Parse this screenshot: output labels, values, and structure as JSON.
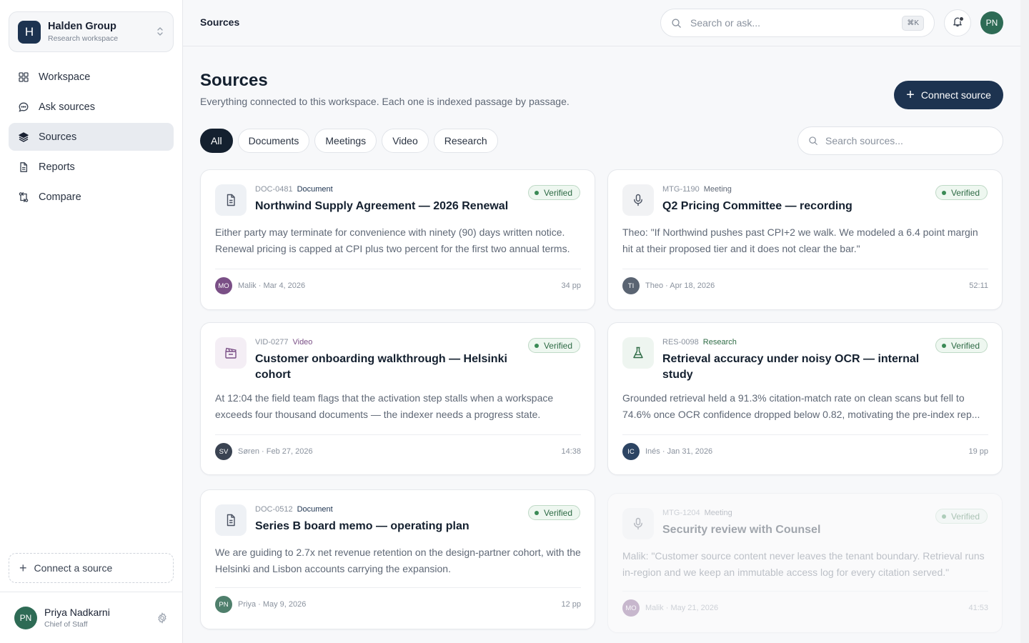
{
  "workspace": {
    "logo_letter": "H",
    "name": "Halden Group",
    "subtitle": "Research workspace"
  },
  "nav": [
    {
      "label": "Workspace",
      "icon": "grid-icon",
      "active": false
    },
    {
      "label": "Ask sources",
      "icon": "chat-icon",
      "active": false
    },
    {
      "label": "Sources",
      "icon": "layers-icon",
      "active": true
    },
    {
      "label": "Reports",
      "icon": "document-icon",
      "active": false
    },
    {
      "label": "Compare",
      "icon": "compare-icon",
      "active": false
    }
  ],
  "sidebar_connect_label": "Connect a source",
  "user": {
    "initials": "PN",
    "name": "Priya Nadkarni",
    "role": "Chief of Staff"
  },
  "topbar": {
    "breadcrumb": "Sources",
    "search_placeholder": "Search or ask...",
    "shortcut": "⌘K",
    "avatar_initials": "PN"
  },
  "page": {
    "title": "Sources",
    "subtitle": "Everything connected to this workspace. Each one is indexed passage by passage.",
    "connect_button": "Connect source",
    "search_placeholder": "Search sources..."
  },
  "filters": [
    "All",
    "Documents",
    "Meetings",
    "Video",
    "Research"
  ],
  "cards": [
    {
      "id": "DOC-0481",
      "kind": "Document",
      "kind_color": "#1d3350",
      "icon": "document-icon",
      "icon_bg": "#eef1f5",
      "title": "Northwind Supply Agreement — 2026 Renewal",
      "status": "Verified",
      "excerpt": "Either party may terminate for convenience with ninety (90) days written notice. Renewal pricing is capped at CPI plus two percent for the first two annual terms.",
      "author_initials": "MO",
      "author_color": "#7a4f86",
      "byline": "Malik · Mar 4, 2026",
      "length": "34 pp"
    },
    {
      "id": "MTG-1190",
      "kind": "Meeting",
      "kind_color": "#5f6876",
      "icon": "microphone-icon",
      "icon_bg": "#f1f2f4",
      "title": "Q2 Pricing Committee — recording",
      "status": "Verified",
      "excerpt": "Theo: \"If Northwind pushes past CPI+2 we walk. We modeled a 6.4 point margin hit at their proposed tier and it does not clear the bar.\"",
      "author_initials": "TI",
      "author_color": "#5a6472",
      "byline": "Theo · Apr 18, 2026",
      "length": "52:11"
    },
    {
      "id": "VID-0277",
      "kind": "Video",
      "kind_color": "#7a4f86",
      "icon": "clapperboard-icon",
      "icon_bg": "#f4eef5",
      "title": "Customer onboarding walkthrough — Helsinki cohort",
      "status": "Verified",
      "excerpt": "At 12:04 the field team flags that the activation step stalls when a workspace exceeds four thousand documents — the indexer needs a progress state.",
      "author_initials": "SV",
      "author_color": "#3a4352",
      "byline": "Søren · Feb 27, 2026",
      "length": "14:38"
    },
    {
      "id": "RES-0098",
      "kind": "Research",
      "kind_color": "#2e6b45",
      "icon": "flask-icon",
      "icon_bg": "#eef5f0",
      "title": "Retrieval accuracy under noisy OCR — internal study",
      "status": "Verified",
      "excerpt": "Grounded retrieval held a 91.3% citation-match rate on clean scans but fell to 74.6% once OCR confidence dropped below 0.82, motivating the pre-index rep...",
      "author_initials": "IC",
      "author_color": "#2c4463",
      "byline": "Inés · Jan 31, 2026",
      "length": "19 pp"
    },
    {
      "id": "DOC-0512",
      "kind": "Document",
      "kind_color": "#1d3350",
      "icon": "document-icon",
      "icon_bg": "#eef1f5",
      "title": "Series B board memo — operating plan",
      "status": "Verified",
      "excerpt": "We are guiding to 2.7x net revenue retention on the design-partner cohort, with the Helsinki and Lisbon accounts carrying the expansion.",
      "author_initials": "PN",
      "author_color": "#4f7f6c",
      "byline": "Priya · May 9, 2026",
      "length": "12 pp"
    },
    {
      "id": "MTG-1204",
      "kind": "Meeting",
      "kind_color": "#5f6876",
      "icon": "microphone-icon",
      "icon_bg": "#f1f2f4",
      "title": "Security review with Counsel",
      "status": "Verified",
      "excerpt": "Malik: \"Customer source content never leaves the tenant boundary. Retrieval runs in-region and we keep an immutable access log for every citation served.\"",
      "author_initials": "MO",
      "author_color": "#7a4f86",
      "byline": "Malik · May 21, 2026",
      "length": "41:53"
    }
  ]
}
